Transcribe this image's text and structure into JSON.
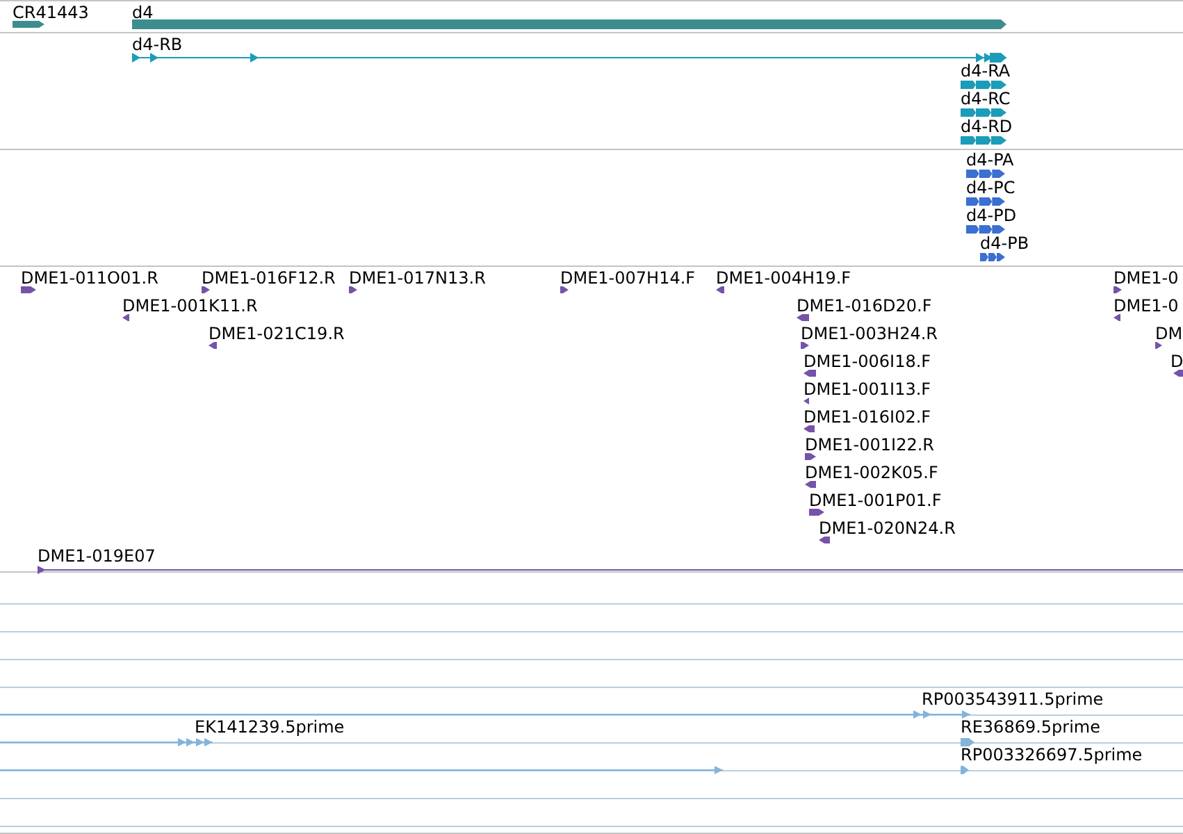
{
  "tracks": [
    {
      "kind": "gene",
      "features": [
        {
          "label": "CR41443",
          "kind": "forward"
        },
        {
          "label": "d4",
          "kind": "forward"
        }
      ]
    },
    {
      "kind": "transcript",
      "features": [
        {
          "label": "d4-RB",
          "kind": "forward"
        },
        {
          "label": "d4-RA",
          "kind": "forward"
        },
        {
          "label": "d4-RC",
          "kind": "forward"
        },
        {
          "label": "d4-RD",
          "kind": "forward"
        }
      ]
    },
    {
      "kind": "protein",
      "features": [
        {
          "label": "d4-PA",
          "kind": "forward"
        },
        {
          "label": "d4-PC",
          "kind": "forward"
        },
        {
          "label": "d4-PD",
          "kind": "forward"
        },
        {
          "label": "d4-PB",
          "kind": "forward"
        }
      ]
    },
    {
      "kind": "clone",
      "features": [
        {
          "label": "DME1-011O01.R",
          "kind": "forward"
        },
        {
          "label": "DME1-016F12.R",
          "kind": "forward"
        },
        {
          "label": "DME1-017N13.R",
          "kind": "forward"
        },
        {
          "label": "DME1-007H14.F",
          "kind": "forward"
        },
        {
          "label": "DME1-004H19.F",
          "kind": "reverse"
        },
        {
          "label": "DME1-0",
          "kind": "forward"
        },
        {
          "label": "DME1-001K11.R",
          "kind": "reverse"
        },
        {
          "label": "DME1-016D20.F",
          "kind": "reverse"
        },
        {
          "label": "DME1-0",
          "kind": "reverse"
        },
        {
          "label": "DME1-021C19.R",
          "kind": "reverse"
        },
        {
          "label": "DME1-003H24.R",
          "kind": "forward"
        },
        {
          "label": "DM",
          "kind": "forward"
        },
        {
          "label": "DME1-006I18.F",
          "kind": "reverse"
        },
        {
          "label": "D",
          "kind": "reverse"
        },
        {
          "label": "DME1-001I13.F",
          "kind": "reverse"
        },
        {
          "label": "DME1-016I02.F",
          "kind": "reverse"
        },
        {
          "label": "DME1-001I22.R",
          "kind": "forward"
        },
        {
          "label": "DME1-002K05.F",
          "kind": "reverse"
        },
        {
          "label": "DME1-001P01.F",
          "kind": "forward"
        },
        {
          "label": "DME1-020N24.R",
          "kind": "reverse"
        },
        {
          "label": "DME1-019E07",
          "kind": "forward"
        }
      ]
    },
    {
      "kind": "est",
      "features": [
        {
          "label": "RP003543911.5prime",
          "kind": "forward"
        },
        {
          "label": "EK141239.5prime",
          "kind": "forward"
        },
        {
          "label": "RE36869.5prime",
          "kind": "forward"
        },
        {
          "kind": "forward"
        },
        {
          "label": "RP003326697.5prime",
          "kind": "forward"
        }
      ]
    }
  ]
}
